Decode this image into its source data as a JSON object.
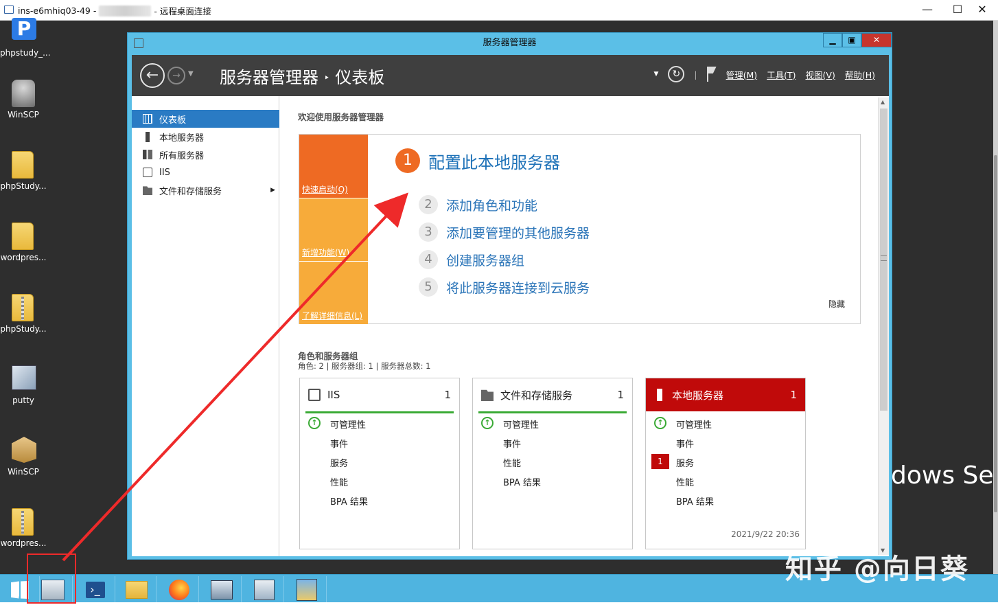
{
  "rdp": {
    "title_prefix": "ins-e6mhiq03-49 -",
    "title_suffix": "- 远程桌面连接",
    "minimize": "—",
    "maximize": "☐",
    "close": "✕"
  },
  "desktop": {
    "icons": [
      {
        "label": "phpstudy_...",
        "icon": "phpstudy-icon"
      },
      {
        "label": "WinSCP",
        "icon": "winscp-lock-icon"
      },
      {
        "label": "phpStudy...",
        "icon": "folder-icon"
      },
      {
        "label": "wordpres...",
        "icon": "folder-icon"
      },
      {
        "label": "phpStudy...",
        "icon": "zip-folder-icon"
      },
      {
        "label": "putty",
        "icon": "putty-icon"
      },
      {
        "label": "WinSCP",
        "icon": "winscp-box-icon"
      },
      {
        "label": "wordpres...",
        "icon": "zip-folder-icon"
      }
    ],
    "background_text": "dows Serv",
    "watermark": "知乎 @向日葵"
  },
  "server_manager": {
    "window_title": "服务器管理器",
    "breadcrumb_root": "服务器管理器",
    "breadcrumb_sep": "‣",
    "breadcrumb_current": "仪表板",
    "menus": [
      "管理(M)",
      "工具(T)",
      "视图(V)",
      "帮助(H)"
    ],
    "sidebar": [
      {
        "label": "仪表板",
        "active": true
      },
      {
        "label": "本地服务器"
      },
      {
        "label": "所有服务器"
      },
      {
        "label": "IIS"
      },
      {
        "label": "文件和存储服务"
      }
    ],
    "welcome_title": "欢迎使用服务器管理器",
    "tiles": [
      "快速启动(Q)",
      "新增功能(W)",
      "了解详细信息(L)"
    ],
    "steps": [
      {
        "num": "1",
        "label": "配置此本地服务器"
      },
      {
        "num": "2",
        "label": "添加角色和功能"
      },
      {
        "num": "3",
        "label": "添加要管理的其他服务器"
      },
      {
        "num": "4",
        "label": "创建服务器组"
      },
      {
        "num": "5",
        "label": "将此服务器连接到云服务"
      }
    ],
    "hide": "隐藏",
    "roles_title": "角色和服务器组",
    "roles_sub": "角色: 2 | 服务器组: 1 | 服务器总数: 1",
    "cards": [
      {
        "title": "IIS",
        "count": "1",
        "rows": [
          "可管理性",
          "事件",
          "服务",
          "性能",
          "BPA 结果"
        ]
      },
      {
        "title": "文件和存储服务",
        "count": "1",
        "rows": [
          "可管理性",
          "事件",
          "性能",
          "BPA 结果"
        ]
      },
      {
        "title": "本地服务器",
        "count": "1",
        "rows": [
          "可管理性",
          "事件",
          "服务",
          "性能",
          "BPA 结果"
        ],
        "badge": "1",
        "timestamp": "2021/9/22 20:36"
      }
    ]
  },
  "colors": {
    "accent_blue": "#2a7bc4",
    "orange": "#ee6a23",
    "red": "#c00a0a",
    "green": "#3aaa35",
    "annotation_red": "#ee2a2a"
  }
}
